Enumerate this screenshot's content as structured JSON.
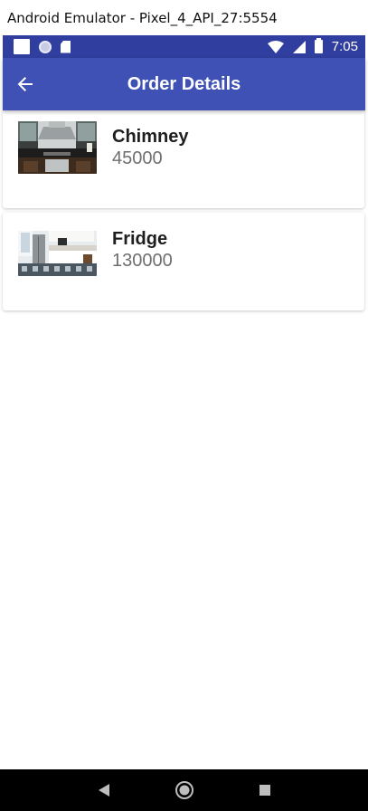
{
  "emulator": {
    "window_title": "Android Emulator - Pixel_4_API_27:5554"
  },
  "status_bar": {
    "time": "7:05",
    "icons_left": [
      "notification-square-icon",
      "sync-circle-icon",
      "sd-card-icon"
    ],
    "icons_right": [
      "wifi-icon",
      "cell-signal-icon",
      "battery-icon"
    ],
    "color": "#303f9f"
  },
  "app_bar": {
    "title": "Order Details",
    "back_icon": "arrow-back-icon",
    "color": "#3f51b5"
  },
  "orders": [
    {
      "name": "Chimney",
      "price": "45000",
      "image": "kitchen-chimney-thumbnail"
    },
    {
      "name": "Fridge",
      "price": "130000",
      "image": "kitchen-fridge-thumbnail"
    }
  ],
  "nav_bar": {
    "buttons": [
      "back-triangle-icon",
      "home-circle-icon",
      "recents-square-icon"
    ]
  }
}
